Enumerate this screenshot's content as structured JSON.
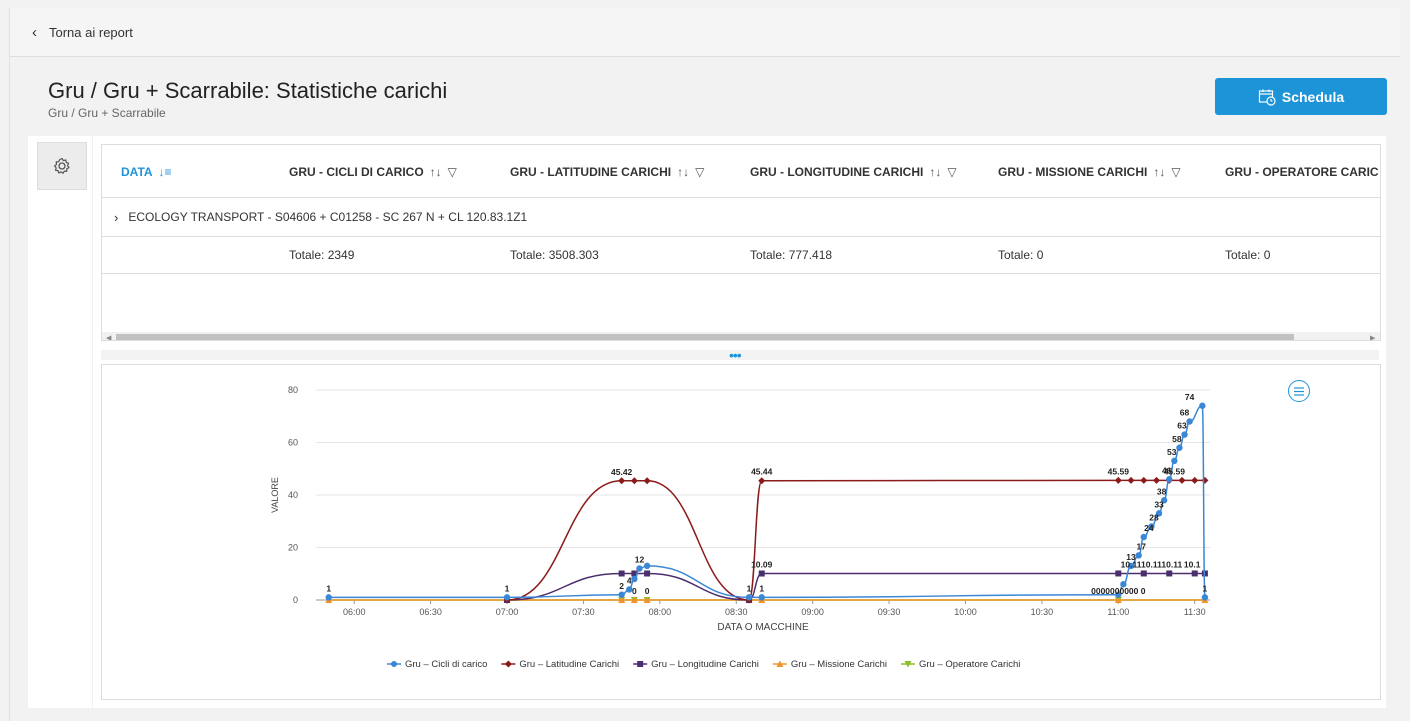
{
  "nav": {
    "back_label": "Torna ai report"
  },
  "page": {
    "title": "Gru / Gru + Scarrabile: Statistiche carichi",
    "subtitle": "Gru / Gru + Scarrabile"
  },
  "toolbar": {
    "schedule_label": "Schedula"
  },
  "grid": {
    "columns": [
      {
        "label": "DATA"
      },
      {
        "label": "GRU - CICLI DI CARICO"
      },
      {
        "label": "GRU - LATITUDINE CARICHI"
      },
      {
        "label": "GRU - LONGITUDINE CARICHI"
      },
      {
        "label": "GRU - MISSIONE CARICHI"
      },
      {
        "label": "GRU - OPERATORE CARIC"
      }
    ],
    "group_row": "ECOLOGY TRANSPORT - S04606 + C01258 - SC 267 N + CL 120.83.1Z1",
    "totals": [
      "Totale: 2349",
      "Totale: 3508.303",
      "Totale: 777.418",
      "Totale: 0",
      "Totale: 0"
    ]
  },
  "chart_data": {
    "type": "line",
    "xlabel": "DATA O MACCHINE",
    "ylabel": "VALORE",
    "ylim": [
      0,
      80
    ],
    "yticks": [
      "0",
      "20",
      "40",
      "60",
      "80"
    ],
    "xticks": [
      "06:00",
      "06:30",
      "07:00",
      "07:30",
      "08:00",
      "08:30",
      "09:00",
      "09:30",
      "10:00",
      "10:30",
      "11:00",
      "11:30"
    ],
    "legend_position": "bottom",
    "series": [
      {
        "name": "Gru – Cicli di carico",
        "color": "#3a87d6",
        "x": [
          "05:50",
          "07:00",
          "07:45",
          "07:48",
          "07:50",
          "07:52",
          "07:55",
          "08:35",
          "08:40",
          "11:00",
          "11:02",
          "11:05",
          "11:08",
          "11:10",
          "11:13",
          "11:16",
          "11:18",
          "11:20",
          "11:22",
          "11:24",
          "11:26",
          "11:28",
          "11:33",
          "11:34"
        ],
        "values": [
          1,
          1,
          2,
          4,
          8,
          12,
          13,
          1,
          1,
          2,
          6,
          13,
          17,
          24,
          28,
          33,
          38,
          46,
          53,
          58,
          63,
          68,
          74,
          1
        ]
      },
      {
        "name": "Gru – Latitudine Carichi",
        "color": "#8b1a1a",
        "x": [
          "07:00",
          "07:45",
          "07:50",
          "07:55",
          "08:35",
          "08:40",
          "11:00",
          "11:05",
          "11:10",
          "11:15",
          "11:20",
          "11:25",
          "11:30",
          "11:34"
        ],
        "values": [
          0,
          45.42,
          45.42,
          45.42,
          0,
          45.44,
          45.59,
          45.59,
          45.59,
          45.59,
          45.59,
          45.59,
          45.59,
          45.59
        ]
      },
      {
        "name": "Gru – Longitudine Carichi",
        "color": "#4b2e6e",
        "x": [
          "07:00",
          "07:45",
          "07:50",
          "07:55",
          "08:35",
          "08:40",
          "11:00",
          "11:10",
          "11:20",
          "11:30",
          "11:34"
        ],
        "values": [
          0,
          10.1,
          10.1,
          10.1,
          0,
          10.09,
          10.11,
          10.11,
          10.11,
          10.11,
          10.11
        ]
      },
      {
        "name": "Gru – Missione Carichi",
        "color": "#f0932b",
        "x": [
          "05:50",
          "07:00",
          "07:45",
          "07:50",
          "07:55",
          "08:35",
          "08:40",
          "11:00",
          "11:34"
        ],
        "values": [
          0,
          0,
          0,
          0,
          0,
          0,
          0,
          0,
          0
        ]
      },
      {
        "name": "Gru – Operatore Carichi",
        "color": "#8cbf26",
        "x": [
          "05:50",
          "07:00",
          "07:45",
          "07:50",
          "07:55",
          "08:35",
          "08:40",
          "11:00",
          "11:34"
        ],
        "values": [
          0,
          0,
          0,
          0,
          0,
          0,
          0,
          0,
          0
        ]
      }
    ],
    "labels": [
      {
        "text": "1",
        "series": 0,
        "x": "05:50",
        "y": 1
      },
      {
        "text": "1",
        "series": 0,
        "x": "07:00",
        "y": 1
      },
      {
        "text": "2",
        "series": 0,
        "x": "07:45",
        "y": 2
      },
      {
        "text": "4",
        "series": 0,
        "x": "07:48",
        "y": 4
      },
      {
        "text": "12",
        "series": 0,
        "x": "07:52",
        "y": 12
      },
      {
        "text": "1",
        "series": 0,
        "x": "08:35",
        "y": 1
      },
      {
        "text": "1",
        "series": 0,
        "x": "08:40",
        "y": 1
      },
      {
        "text": "74",
        "series": 0,
        "x": "11:28",
        "y": 74
      },
      {
        "text": "68",
        "series": 0,
        "x": "11:26",
        "y": 68
      },
      {
        "text": "63",
        "series": 0,
        "x": "11:25",
        "y": 63
      },
      {
        "text": "58",
        "series": 0,
        "x": "11:23",
        "y": 58
      },
      {
        "text": "53",
        "series": 0,
        "x": "11:21",
        "y": 53
      },
      {
        "text": "46",
        "series": 0,
        "x": "11:19",
        "y": 46
      },
      {
        "text": "38",
        "series": 0,
        "x": "11:17",
        "y": 38
      },
      {
        "text": "33",
        "series": 0,
        "x": "11:16",
        "y": 33
      },
      {
        "text": "28",
        "series": 0,
        "x": "11:14",
        "y": 28
      },
      {
        "text": "24",
        "series": 0,
        "x": "11:12",
        "y": 24
      },
      {
        "text": "17",
        "series": 0,
        "x": "11:09",
        "y": 17
      },
      {
        "text": "13",
        "series": 0,
        "x": "11:05",
        "y": 13
      },
      {
        "text": "1",
        "series": 0,
        "x": "11:34",
        "y": 1
      },
      {
        "text": "45.42",
        "series": 1,
        "x": "07:45",
        "y": 45.42
      },
      {
        "text": "45.44",
        "series": 1,
        "x": "08:40",
        "y": 45.44
      },
      {
        "text": "45.59",
        "series": 1,
        "x": "11:00",
        "y": 45.59
      },
      {
        "text": "45.59",
        "series": 1,
        "x": "11:22",
        "y": 45.59
      },
      {
        "text": "10.09",
        "series": 2,
        "x": "08:40",
        "y": 10.09
      },
      {
        "text": "10.11",
        "series": 2,
        "x": "11:05",
        "y": 10.11
      },
      {
        "text": "10.11",
        "series": 2,
        "x": "11:13",
        "y": 10.11
      },
      {
        "text": "10.11",
        "series": 2,
        "x": "11:21",
        "y": 10.11
      },
      {
        "text": "10.1",
        "series": 2,
        "x": "11:29",
        "y": 10.1
      },
      {
        "text": "0",
        "series": 3,
        "x": "07:50",
        "y": 0
      },
      {
        "text": "0",
        "series": 3,
        "x": "07:55",
        "y": 0
      },
      {
        "text": "0000000000 0",
        "series": 3,
        "x": "11:00",
        "y": 0
      }
    ]
  }
}
